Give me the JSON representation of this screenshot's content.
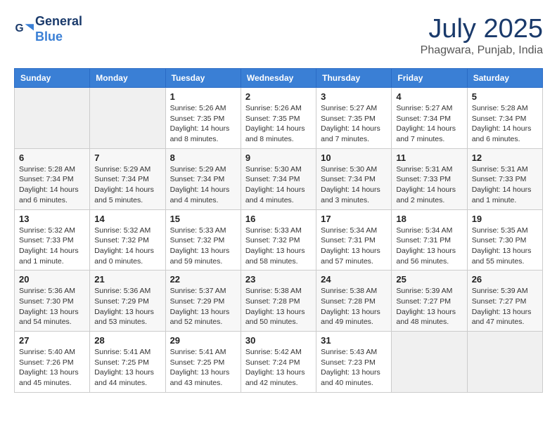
{
  "header": {
    "logo_line1": "General",
    "logo_line2": "Blue",
    "month": "July 2025",
    "location": "Phagwara, Punjab, India"
  },
  "weekdays": [
    "Sunday",
    "Monday",
    "Tuesday",
    "Wednesday",
    "Thursday",
    "Friday",
    "Saturday"
  ],
  "weeks": [
    [
      {
        "day": "",
        "info": ""
      },
      {
        "day": "",
        "info": ""
      },
      {
        "day": "1",
        "info": "Sunrise: 5:26 AM\nSunset: 7:35 PM\nDaylight: 14 hours and 8 minutes."
      },
      {
        "day": "2",
        "info": "Sunrise: 5:26 AM\nSunset: 7:35 PM\nDaylight: 14 hours and 8 minutes."
      },
      {
        "day": "3",
        "info": "Sunrise: 5:27 AM\nSunset: 7:35 PM\nDaylight: 14 hours and 7 minutes."
      },
      {
        "day": "4",
        "info": "Sunrise: 5:27 AM\nSunset: 7:34 PM\nDaylight: 14 hours and 7 minutes."
      },
      {
        "day": "5",
        "info": "Sunrise: 5:28 AM\nSunset: 7:34 PM\nDaylight: 14 hours and 6 minutes."
      }
    ],
    [
      {
        "day": "6",
        "info": "Sunrise: 5:28 AM\nSunset: 7:34 PM\nDaylight: 14 hours and 6 minutes."
      },
      {
        "day": "7",
        "info": "Sunrise: 5:29 AM\nSunset: 7:34 PM\nDaylight: 14 hours and 5 minutes."
      },
      {
        "day": "8",
        "info": "Sunrise: 5:29 AM\nSunset: 7:34 PM\nDaylight: 14 hours and 4 minutes."
      },
      {
        "day": "9",
        "info": "Sunrise: 5:30 AM\nSunset: 7:34 PM\nDaylight: 14 hours and 4 minutes."
      },
      {
        "day": "10",
        "info": "Sunrise: 5:30 AM\nSunset: 7:34 PM\nDaylight: 14 hours and 3 minutes."
      },
      {
        "day": "11",
        "info": "Sunrise: 5:31 AM\nSunset: 7:33 PM\nDaylight: 14 hours and 2 minutes."
      },
      {
        "day": "12",
        "info": "Sunrise: 5:31 AM\nSunset: 7:33 PM\nDaylight: 14 hours and 1 minute."
      }
    ],
    [
      {
        "day": "13",
        "info": "Sunrise: 5:32 AM\nSunset: 7:33 PM\nDaylight: 14 hours and 1 minute."
      },
      {
        "day": "14",
        "info": "Sunrise: 5:32 AM\nSunset: 7:32 PM\nDaylight: 14 hours and 0 minutes."
      },
      {
        "day": "15",
        "info": "Sunrise: 5:33 AM\nSunset: 7:32 PM\nDaylight: 13 hours and 59 minutes."
      },
      {
        "day": "16",
        "info": "Sunrise: 5:33 AM\nSunset: 7:32 PM\nDaylight: 13 hours and 58 minutes."
      },
      {
        "day": "17",
        "info": "Sunrise: 5:34 AM\nSunset: 7:31 PM\nDaylight: 13 hours and 57 minutes."
      },
      {
        "day": "18",
        "info": "Sunrise: 5:34 AM\nSunset: 7:31 PM\nDaylight: 13 hours and 56 minutes."
      },
      {
        "day": "19",
        "info": "Sunrise: 5:35 AM\nSunset: 7:30 PM\nDaylight: 13 hours and 55 minutes."
      }
    ],
    [
      {
        "day": "20",
        "info": "Sunrise: 5:36 AM\nSunset: 7:30 PM\nDaylight: 13 hours and 54 minutes."
      },
      {
        "day": "21",
        "info": "Sunrise: 5:36 AM\nSunset: 7:29 PM\nDaylight: 13 hours and 53 minutes."
      },
      {
        "day": "22",
        "info": "Sunrise: 5:37 AM\nSunset: 7:29 PM\nDaylight: 13 hours and 52 minutes."
      },
      {
        "day": "23",
        "info": "Sunrise: 5:38 AM\nSunset: 7:28 PM\nDaylight: 13 hours and 50 minutes."
      },
      {
        "day": "24",
        "info": "Sunrise: 5:38 AM\nSunset: 7:28 PM\nDaylight: 13 hours and 49 minutes."
      },
      {
        "day": "25",
        "info": "Sunrise: 5:39 AM\nSunset: 7:27 PM\nDaylight: 13 hours and 48 minutes."
      },
      {
        "day": "26",
        "info": "Sunrise: 5:39 AM\nSunset: 7:27 PM\nDaylight: 13 hours and 47 minutes."
      }
    ],
    [
      {
        "day": "27",
        "info": "Sunrise: 5:40 AM\nSunset: 7:26 PM\nDaylight: 13 hours and 45 minutes."
      },
      {
        "day": "28",
        "info": "Sunrise: 5:41 AM\nSunset: 7:25 PM\nDaylight: 13 hours and 44 minutes."
      },
      {
        "day": "29",
        "info": "Sunrise: 5:41 AM\nSunset: 7:25 PM\nDaylight: 13 hours and 43 minutes."
      },
      {
        "day": "30",
        "info": "Sunrise: 5:42 AM\nSunset: 7:24 PM\nDaylight: 13 hours and 42 minutes."
      },
      {
        "day": "31",
        "info": "Sunrise: 5:43 AM\nSunset: 7:23 PM\nDaylight: 13 hours and 40 minutes."
      },
      {
        "day": "",
        "info": ""
      },
      {
        "day": "",
        "info": ""
      }
    ]
  ]
}
